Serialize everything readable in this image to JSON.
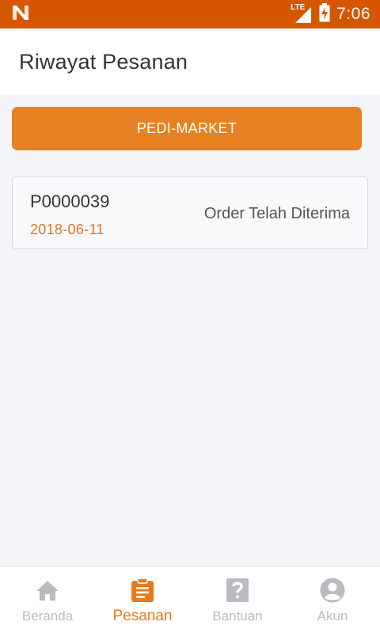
{
  "status_bar": {
    "network_label": "LTE",
    "time": "7:06"
  },
  "header": {
    "title": "Riwayat Pesanan"
  },
  "market_button": {
    "label": "PEDI-MARKET"
  },
  "orders": [
    {
      "id": "P0000039",
      "date": "2018-06-11",
      "status": "Order Telah Diterima"
    }
  ],
  "bottom_nav": {
    "items": [
      {
        "label": "Beranda",
        "icon": "home-icon",
        "active": false
      },
      {
        "label": "Pesanan",
        "icon": "clipboard-icon",
        "active": true
      },
      {
        "label": "Bantuan",
        "icon": "help-icon",
        "active": false
      },
      {
        "label": "Akun",
        "icon": "account-icon",
        "active": false
      }
    ]
  },
  "colors": {
    "status_bar": "#d45700",
    "accent": "#e78223",
    "date_text": "#e0761c",
    "nav_inactive": "#b8bcc2",
    "background": "#f3f5f9"
  }
}
